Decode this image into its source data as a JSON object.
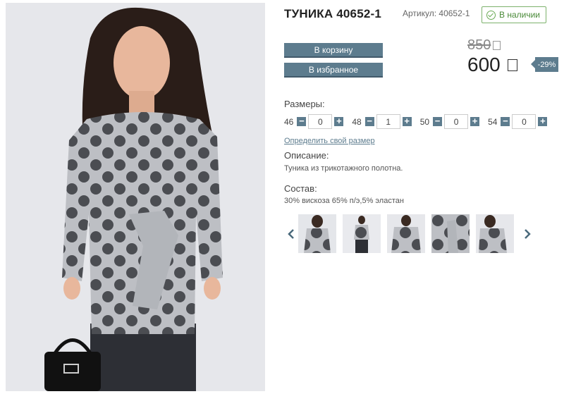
{
  "product": {
    "title": "ТУНИКА 40652-1",
    "sku": "Артикул: 40652-1",
    "stock": "В наличии",
    "old_price": "850",
    "new_price": "600",
    "discount": "-29%"
  },
  "actions": {
    "cart_label": "В корзину",
    "fav_label": "В избранное"
  },
  "sizes": {
    "label": "Размеры:",
    "items": [
      {
        "size": "46",
        "qty": "0"
      },
      {
        "size": "48",
        "qty": "1"
      },
      {
        "size": "50",
        "qty": "0"
      },
      {
        "size": "54",
        "qty": "0"
      }
    ],
    "minus": "−",
    "plus": "+",
    "link": "Определить свой размер"
  },
  "description": {
    "label": "Описание:",
    "text": "Туника из трикотажного полотна."
  },
  "composition": {
    "label": "Состав:",
    "text": "30% вискоза 65% п/э,5% эластан"
  },
  "gallery": {
    "thumb_count_visible": 5
  },
  "colors": {
    "accent": "#5d7c8e",
    "stock_green": "#4a8a38",
    "garment_gray": "#b9bcc2",
    "dot_dark": "#4b4d52"
  }
}
